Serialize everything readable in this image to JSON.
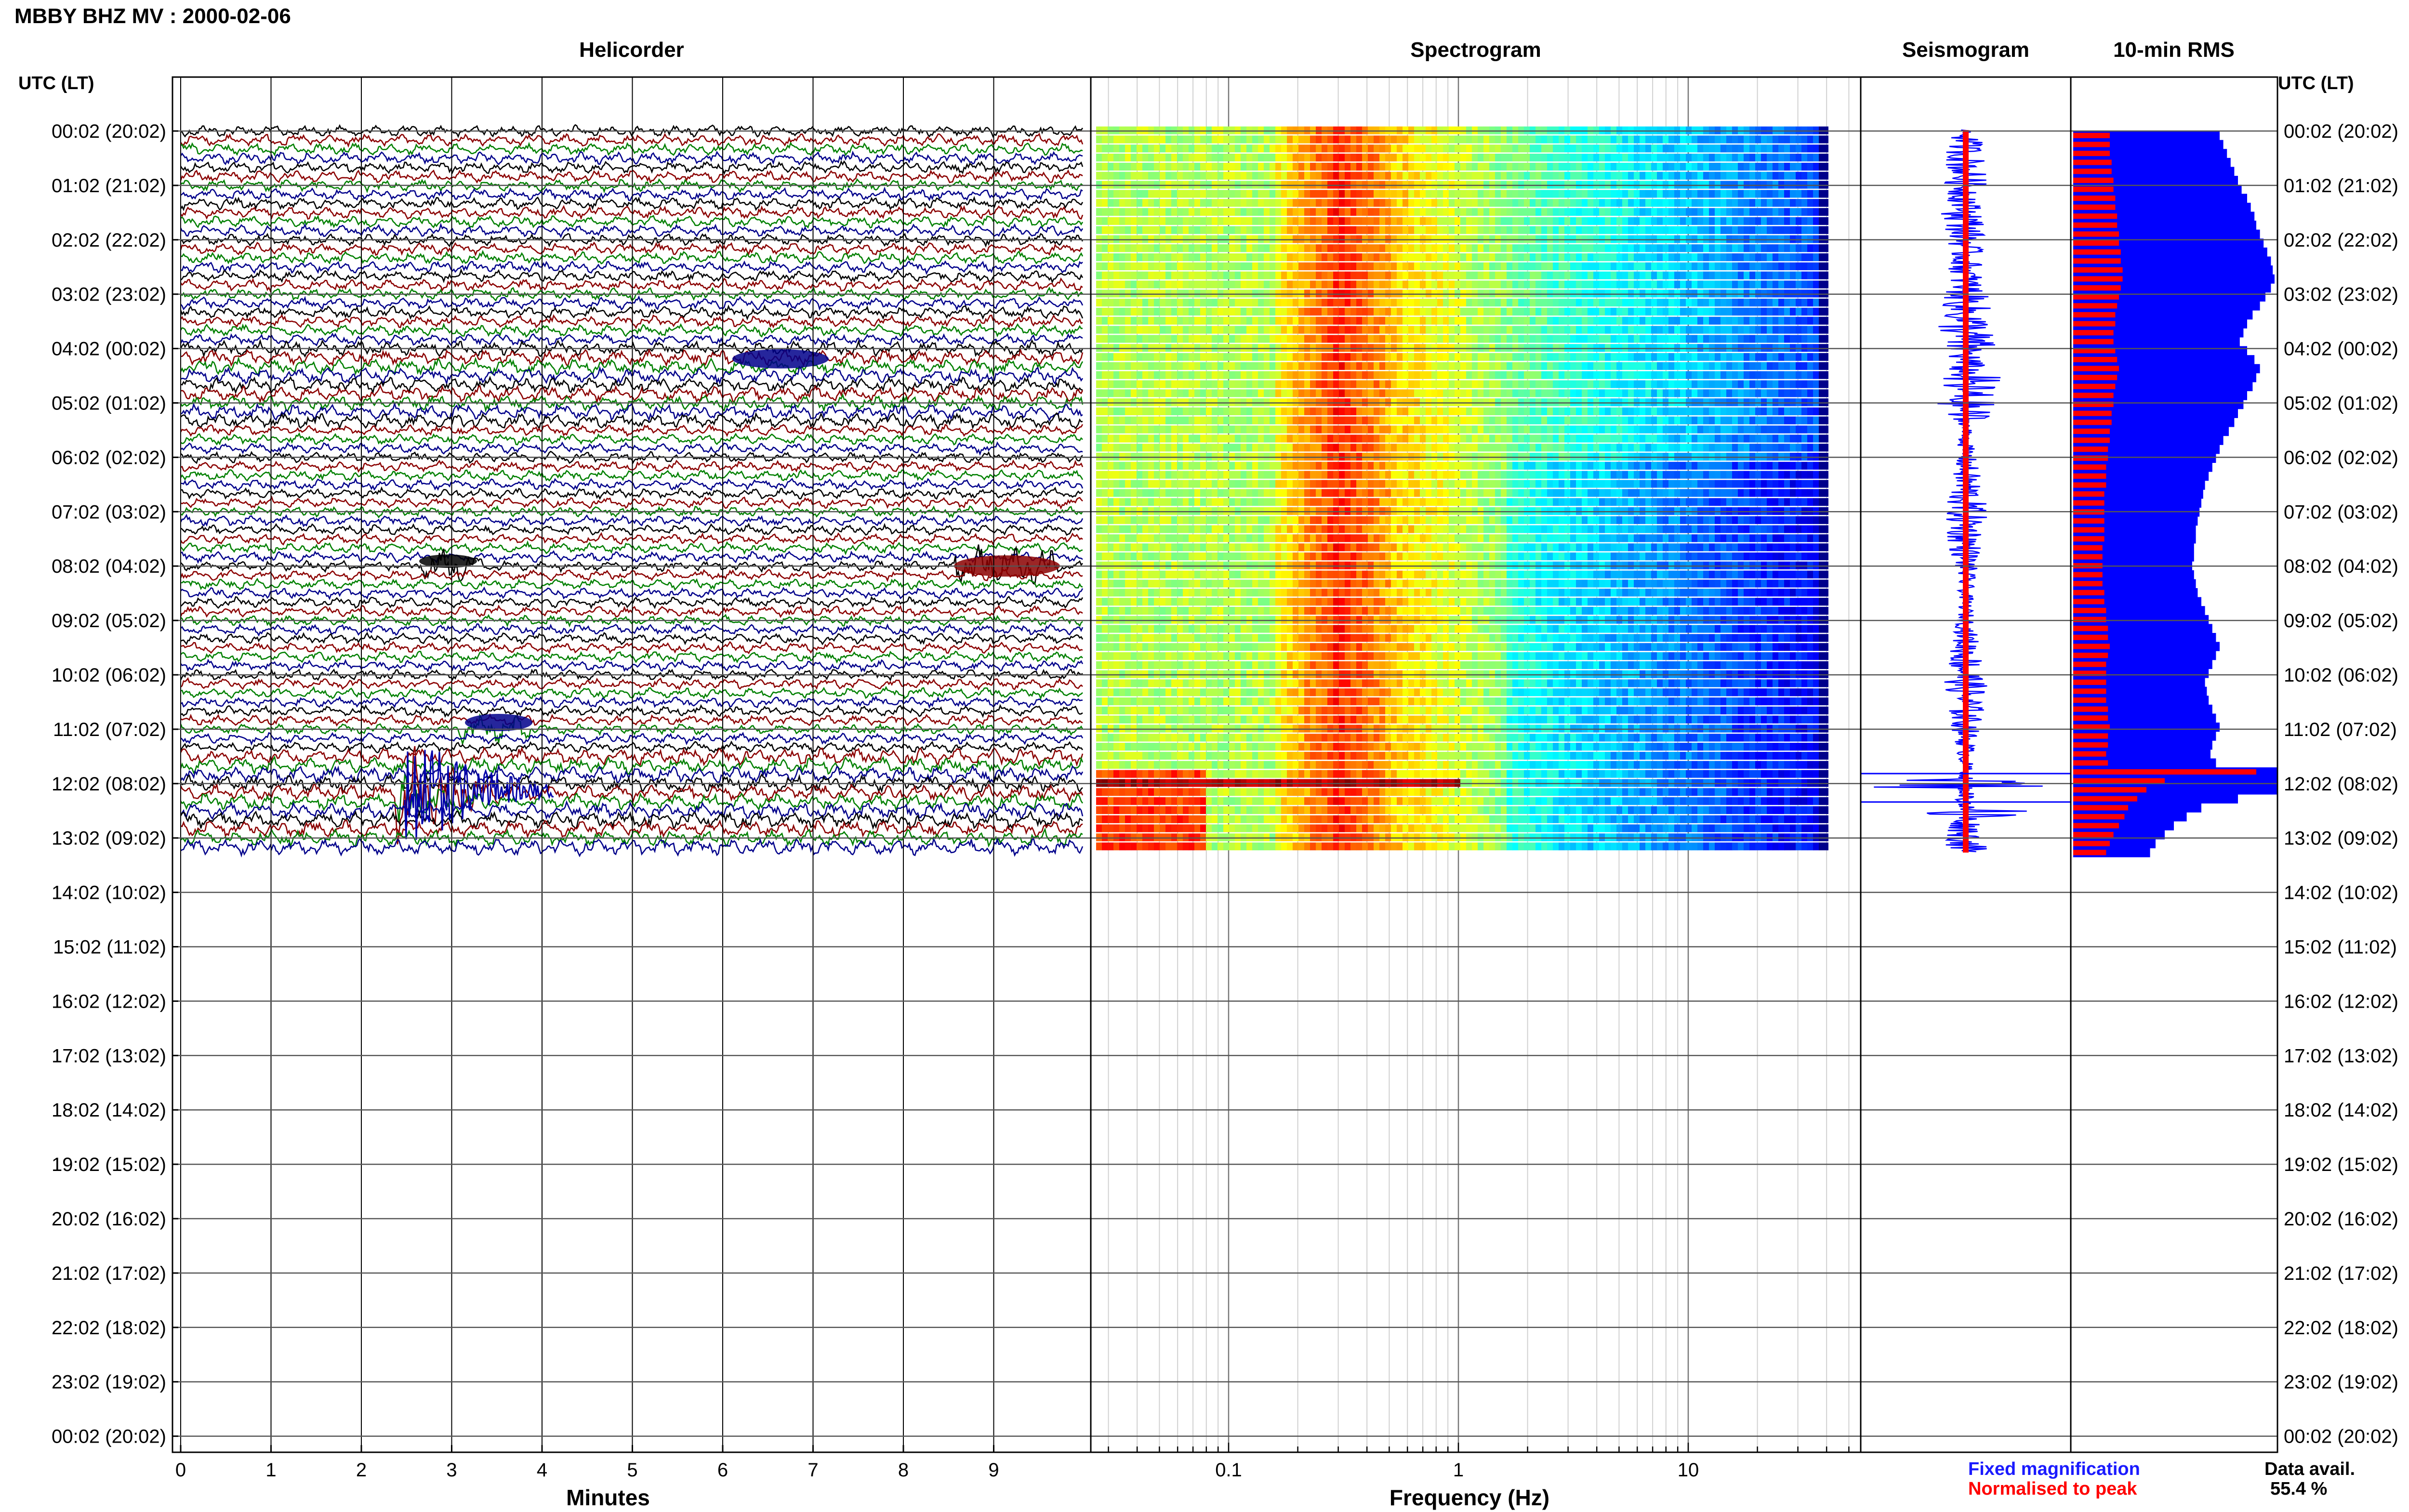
{
  "header": {
    "title": "MBBY BHZ MV : 2000-02-06"
  },
  "panels": {
    "helicorder_title": "Helicorder",
    "spectrogram_title": "Spectrogram",
    "seismogram_title": "Seismogram",
    "rms_title": "10-min RMS"
  },
  "axes": {
    "left_label": "UTC (LT)",
    "right_label": "UTC (LT)",
    "minutes_label": "Minutes",
    "frequency_label": "Frequency (Hz)"
  },
  "time_ticks": [
    "00:02 (20:02)",
    "01:02 (21:02)",
    "02:02 (22:02)",
    "03:02 (23:02)",
    "04:02 (00:02)",
    "05:02 (01:02)",
    "06:02 (02:02)",
    "07:02 (03:02)",
    "08:02 (04:02)",
    "09:02 (05:02)",
    "10:02 (06:02)",
    "11:02 (07:02)",
    "12:02 (08:02)",
    "13:02 (09:02)",
    "14:02 (10:02)",
    "15:02 (11:02)",
    "16:02 (12:02)",
    "17:02 (13:02)",
    "18:02 (14:02)",
    "19:02 (15:02)",
    "20:02 (16:02)",
    "21:02 (17:02)",
    "22:02 (18:02)",
    "23:02 (19:02)",
    "00:02 (20:02)"
  ],
  "minute_ticks": [
    "0",
    "1",
    "2",
    "3",
    "4",
    "5",
    "6",
    "7",
    "8",
    "9"
  ],
  "frequency_ticks": [
    "0.1",
    "1",
    "10"
  ],
  "legend": {
    "fixed": "Fixed magnification",
    "normalised": "Normalised to peak",
    "fixed_color": "#1a1aff",
    "normalised_color": "#ff0000"
  },
  "availability": {
    "label": "Data avail.",
    "value": "55.4 %"
  },
  "colors": {
    "helicorder_traces": [
      "#000000",
      "#8b0000",
      "#008000",
      "#00008b"
    ],
    "rms_fixed": "#0000ff",
    "rms_normalised": "#ff0000"
  },
  "chart_data": {
    "type": "heatmap",
    "title": "MBBY BHZ MV : 2000-02-06",
    "xlabel": "Frequency (Hz)",
    "xscale": "log",
    "ylabel": "UTC (LT)",
    "rows_with_data_hours": 13.5,
    "hours_total": 24,
    "data_available_percent": 55.4,
    "rms_10min": {
      "fixed_magnification": [
        0.8,
        0.82,
        0.84,
        0.86,
        0.88,
        0.9,
        0.92,
        0.95,
        0.97,
        0.99,
        1.0,
        1.02,
        1.04,
        1.06,
        1.08,
        1.09,
        1.1,
        1.08,
        1.05,
        1.02,
        0.98,
        0.95,
        0.93,
        0.91,
        0.95,
        0.99,
        1.02,
        1.0,
        0.98,
        0.95,
        0.93,
        0.9,
        0.88,
        0.85,
        0.82,
        0.8,
        0.78,
        0.76,
        0.74,
        0.72,
        0.71,
        0.7,
        0.69,
        0.68,
        0.67,
        0.67,
        0.66,
        0.66,
        0.65,
        0.66,
        0.67,
        0.68,
        0.7,
        0.72,
        0.74,
        0.76,
        0.78,
        0.8,
        0.78,
        0.76,
        0.74,
        0.72,
        0.73,
        0.74,
        0.76,
        0.78,
        0.8,
        0.78,
        0.76,
        0.75,
        0.78,
        1.12,
        1.15,
        1.12,
        0.9,
        0.7,
        0.62,
        0.55,
        0.5,
        0.45,
        0.42
      ],
      "normalised_to_peak": [
        0.2,
        0.2,
        0.2,
        0.21,
        0.21,
        0.22,
        0.22,
        0.23,
        0.23,
        0.24,
        0.24,
        0.25,
        0.25,
        0.26,
        0.26,
        0.27,
        0.27,
        0.26,
        0.25,
        0.24,
        0.23,
        0.23,
        0.22,
        0.22,
        0.23,
        0.24,
        0.25,
        0.24,
        0.23,
        0.22,
        0.22,
        0.21,
        0.21,
        0.2,
        0.2,
        0.19,
        0.19,
        0.18,
        0.18,
        0.18,
        0.17,
        0.17,
        0.17,
        0.17,
        0.17,
        0.17,
        0.16,
        0.16,
        0.16,
        0.16,
        0.16,
        0.17,
        0.17,
        0.18,
        0.18,
        0.19,
        0.19,
        0.2,
        0.19,
        0.18,
        0.18,
        0.18,
        0.18,
        0.18,
        0.19,
        0.19,
        0.2,
        0.19,
        0.19,
        0.18,
        0.19,
        1.0,
        0.5,
        0.4,
        0.35,
        0.3,
        0.28,
        0.25,
        0.22,
        0.2,
        0.18
      ]
    }
  }
}
